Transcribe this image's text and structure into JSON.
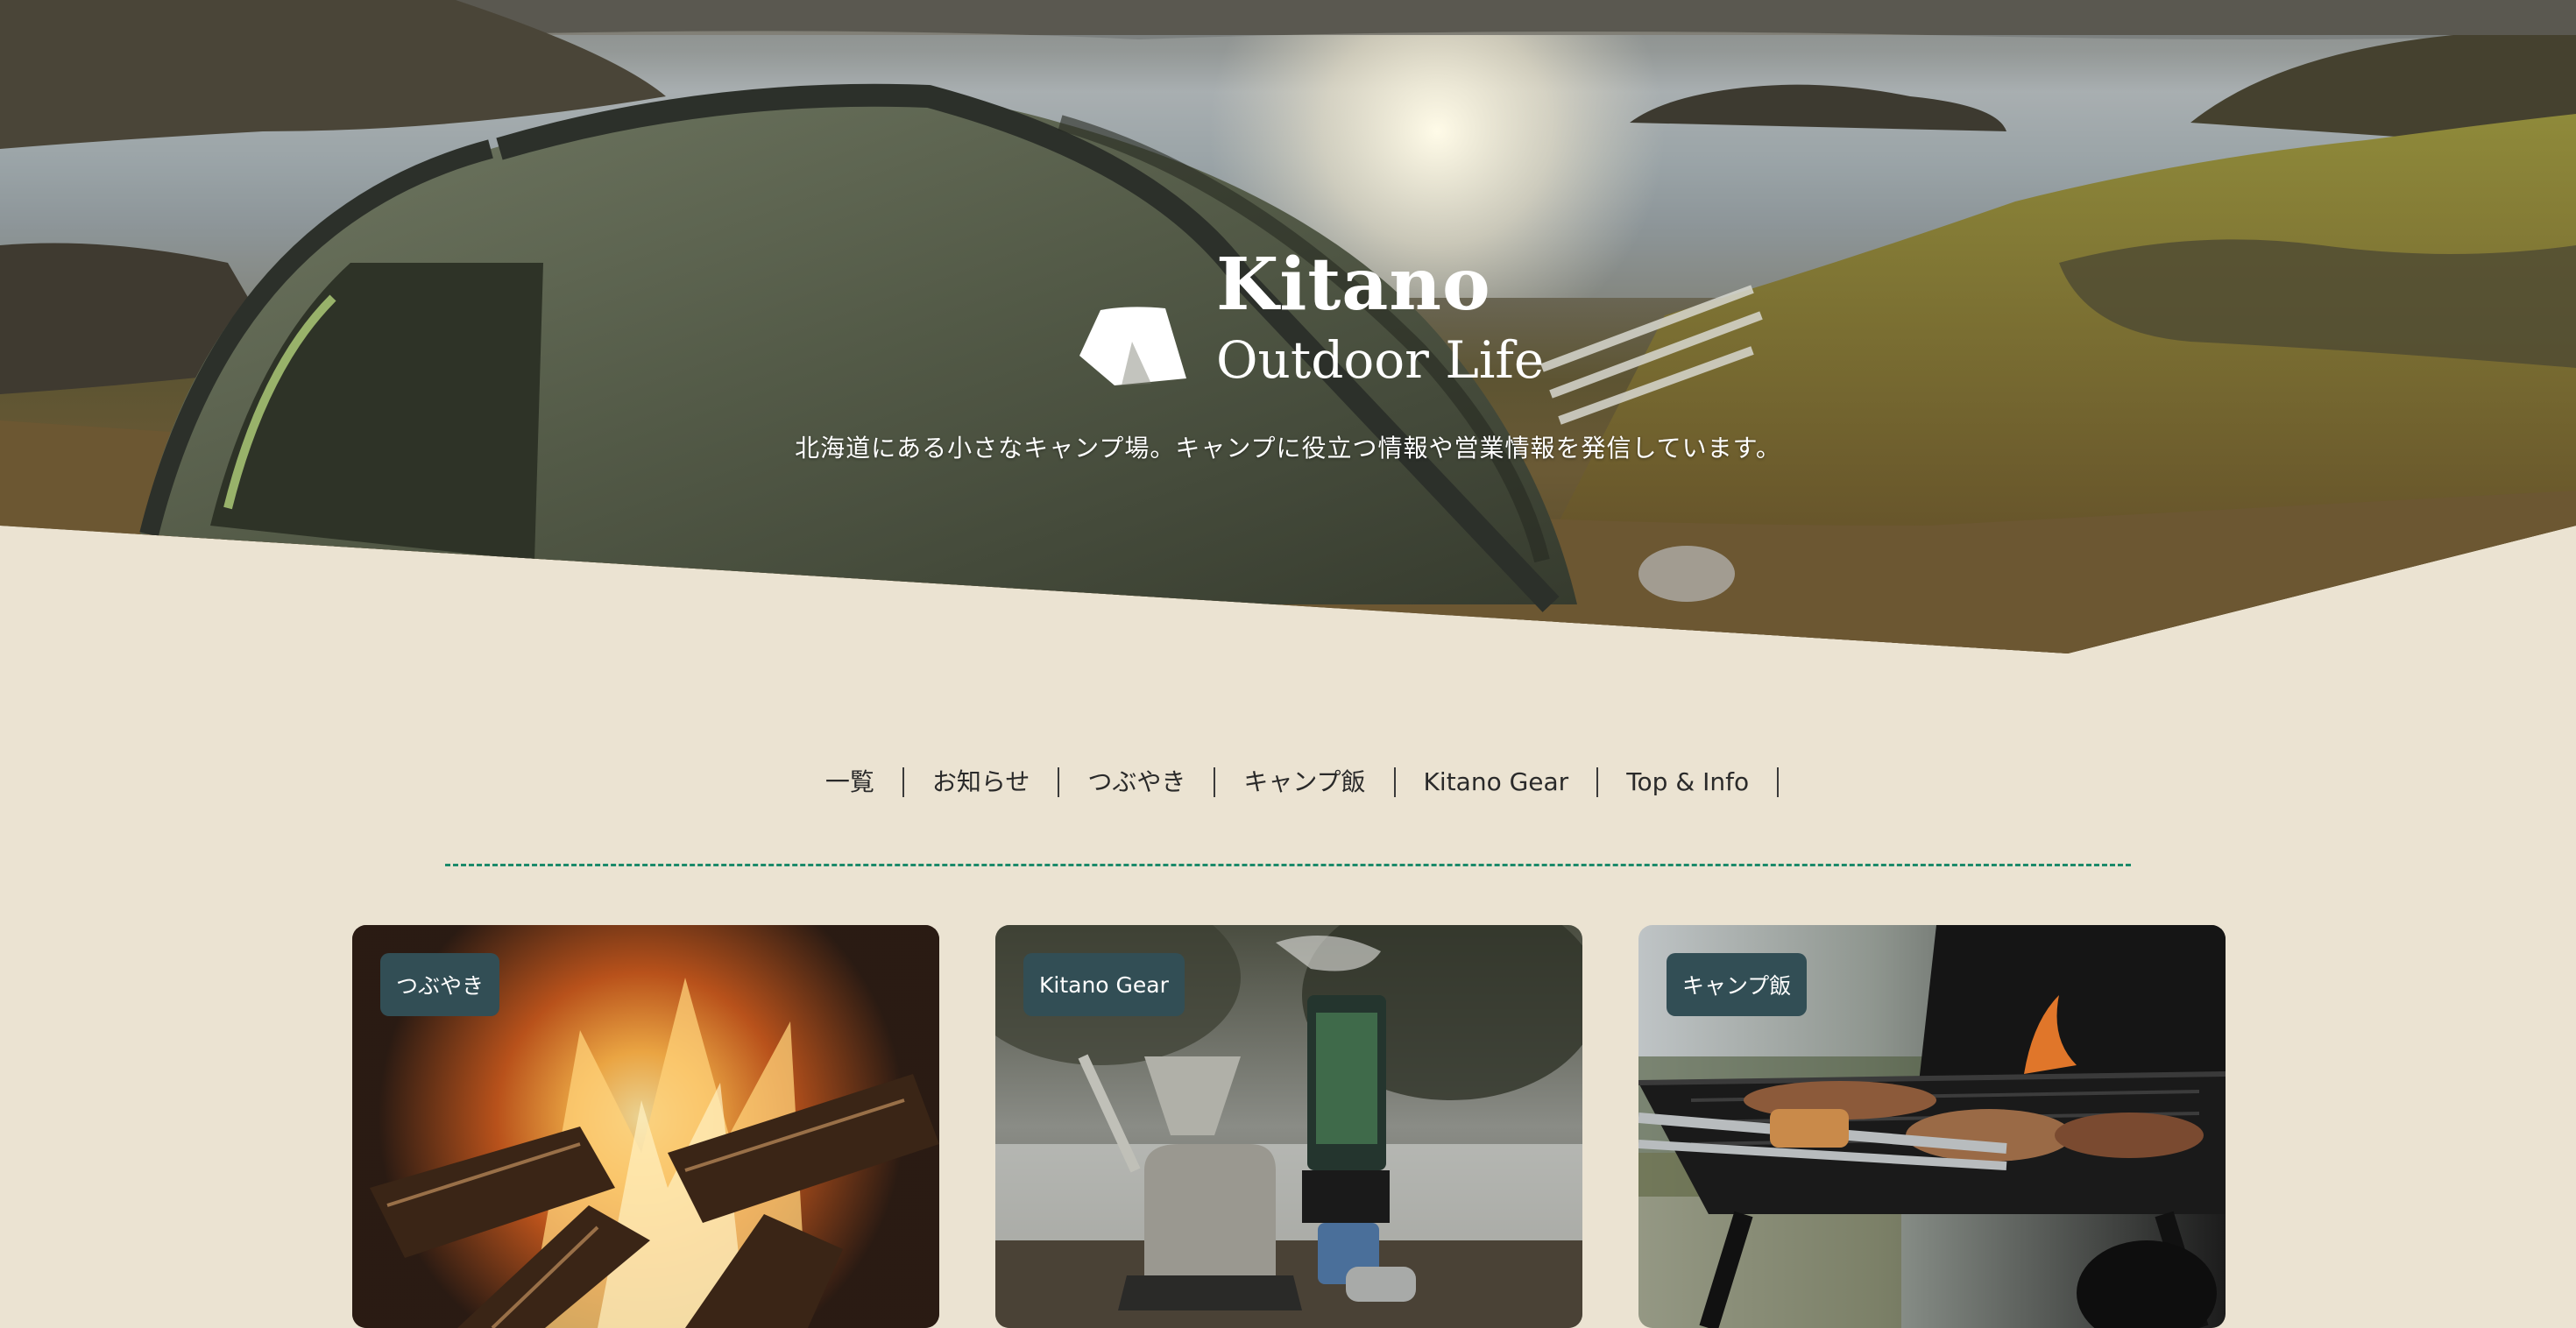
{
  "hero": {
    "brand_name": "Kitano",
    "brand_sub": "Outdoor Life",
    "tagline": "北海道にある小さなキャンプ場。キャンプに役立つ情報や営業情報を発信しています。"
  },
  "nav": {
    "items": [
      {
        "label": "一覧"
      },
      {
        "label": "お知らせ"
      },
      {
        "label": "つぶやき"
      },
      {
        "label": "キャンプ飯"
      },
      {
        "label": "Kitano Gear"
      },
      {
        "label": "Top & Info"
      }
    ]
  },
  "cards": [
    {
      "category": "つぶやき",
      "image": "campfire"
    },
    {
      "category": "Kitano Gear",
      "image": "camp-stove-coffee"
    },
    {
      "category": "キャンプ飯",
      "image": "bbq-grill"
    }
  ],
  "colors": {
    "page_background": "#ebe3d2",
    "divider": "#1b8a6a",
    "badge_background": "#324e55",
    "text": "#2a2a2a"
  }
}
